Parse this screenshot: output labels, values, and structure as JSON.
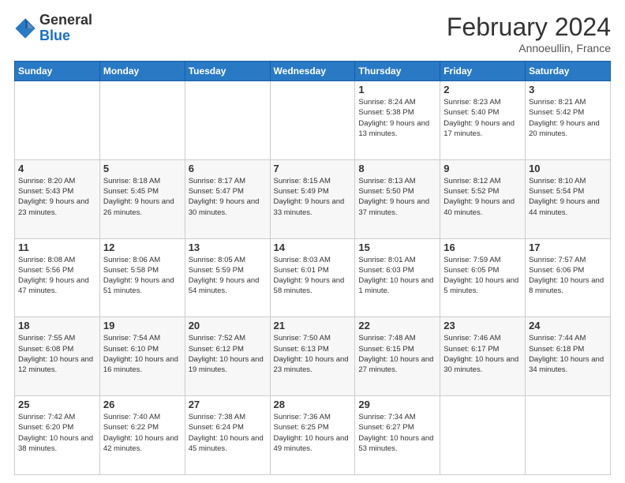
{
  "logo": {
    "general": "General",
    "blue": "Blue"
  },
  "title": {
    "month_year": "February 2024",
    "location": "Annoeullin, France"
  },
  "weekdays": [
    "Sunday",
    "Monday",
    "Tuesday",
    "Wednesday",
    "Thursday",
    "Friday",
    "Saturday"
  ],
  "weeks": [
    [
      {
        "day": "",
        "info": ""
      },
      {
        "day": "",
        "info": ""
      },
      {
        "day": "",
        "info": ""
      },
      {
        "day": "",
        "info": ""
      },
      {
        "day": "1",
        "info": "Sunrise: 8:24 AM\nSunset: 5:38 PM\nDaylight: 9 hours\nand 13 minutes."
      },
      {
        "day": "2",
        "info": "Sunrise: 8:23 AM\nSunset: 5:40 PM\nDaylight: 9 hours\nand 17 minutes."
      },
      {
        "day": "3",
        "info": "Sunrise: 8:21 AM\nSunset: 5:42 PM\nDaylight: 9 hours\nand 20 minutes."
      }
    ],
    [
      {
        "day": "4",
        "info": "Sunrise: 8:20 AM\nSunset: 5:43 PM\nDaylight: 9 hours\nand 23 minutes."
      },
      {
        "day": "5",
        "info": "Sunrise: 8:18 AM\nSunset: 5:45 PM\nDaylight: 9 hours\nand 26 minutes."
      },
      {
        "day": "6",
        "info": "Sunrise: 8:17 AM\nSunset: 5:47 PM\nDaylight: 9 hours\nand 30 minutes."
      },
      {
        "day": "7",
        "info": "Sunrise: 8:15 AM\nSunset: 5:49 PM\nDaylight: 9 hours\nand 33 minutes."
      },
      {
        "day": "8",
        "info": "Sunrise: 8:13 AM\nSunset: 5:50 PM\nDaylight: 9 hours\nand 37 minutes."
      },
      {
        "day": "9",
        "info": "Sunrise: 8:12 AM\nSunset: 5:52 PM\nDaylight: 9 hours\nand 40 minutes."
      },
      {
        "day": "10",
        "info": "Sunrise: 8:10 AM\nSunset: 5:54 PM\nDaylight: 9 hours\nand 44 minutes."
      }
    ],
    [
      {
        "day": "11",
        "info": "Sunrise: 8:08 AM\nSunset: 5:56 PM\nDaylight: 9 hours\nand 47 minutes."
      },
      {
        "day": "12",
        "info": "Sunrise: 8:06 AM\nSunset: 5:58 PM\nDaylight: 9 hours\nand 51 minutes."
      },
      {
        "day": "13",
        "info": "Sunrise: 8:05 AM\nSunset: 5:59 PM\nDaylight: 9 hours\nand 54 minutes."
      },
      {
        "day": "14",
        "info": "Sunrise: 8:03 AM\nSunset: 6:01 PM\nDaylight: 9 hours\nand 58 minutes."
      },
      {
        "day": "15",
        "info": "Sunrise: 8:01 AM\nSunset: 6:03 PM\nDaylight: 10 hours\nand 1 minute."
      },
      {
        "day": "16",
        "info": "Sunrise: 7:59 AM\nSunset: 6:05 PM\nDaylight: 10 hours\nand 5 minutes."
      },
      {
        "day": "17",
        "info": "Sunrise: 7:57 AM\nSunset: 6:06 PM\nDaylight: 10 hours\nand 8 minutes."
      }
    ],
    [
      {
        "day": "18",
        "info": "Sunrise: 7:55 AM\nSunset: 6:08 PM\nDaylight: 10 hours\nand 12 minutes."
      },
      {
        "day": "19",
        "info": "Sunrise: 7:54 AM\nSunset: 6:10 PM\nDaylight: 10 hours\nand 16 minutes."
      },
      {
        "day": "20",
        "info": "Sunrise: 7:52 AM\nSunset: 6:12 PM\nDaylight: 10 hours\nand 19 minutes."
      },
      {
        "day": "21",
        "info": "Sunrise: 7:50 AM\nSunset: 6:13 PM\nDaylight: 10 hours\nand 23 minutes."
      },
      {
        "day": "22",
        "info": "Sunrise: 7:48 AM\nSunset: 6:15 PM\nDaylight: 10 hours\nand 27 minutes."
      },
      {
        "day": "23",
        "info": "Sunrise: 7:46 AM\nSunset: 6:17 PM\nDaylight: 10 hours\nand 30 minutes."
      },
      {
        "day": "24",
        "info": "Sunrise: 7:44 AM\nSunset: 6:18 PM\nDaylight: 10 hours\nand 34 minutes."
      }
    ],
    [
      {
        "day": "25",
        "info": "Sunrise: 7:42 AM\nSunset: 6:20 PM\nDaylight: 10 hours\nand 38 minutes."
      },
      {
        "day": "26",
        "info": "Sunrise: 7:40 AM\nSunset: 6:22 PM\nDaylight: 10 hours\nand 42 minutes."
      },
      {
        "day": "27",
        "info": "Sunrise: 7:38 AM\nSunset: 6:24 PM\nDaylight: 10 hours\nand 45 minutes."
      },
      {
        "day": "28",
        "info": "Sunrise: 7:36 AM\nSunset: 6:25 PM\nDaylight: 10 hours\nand 49 minutes."
      },
      {
        "day": "29",
        "info": "Sunrise: 7:34 AM\nSunset: 6:27 PM\nDaylight: 10 hours\nand 53 minutes."
      },
      {
        "day": "",
        "info": ""
      },
      {
        "day": "",
        "info": ""
      }
    ]
  ]
}
